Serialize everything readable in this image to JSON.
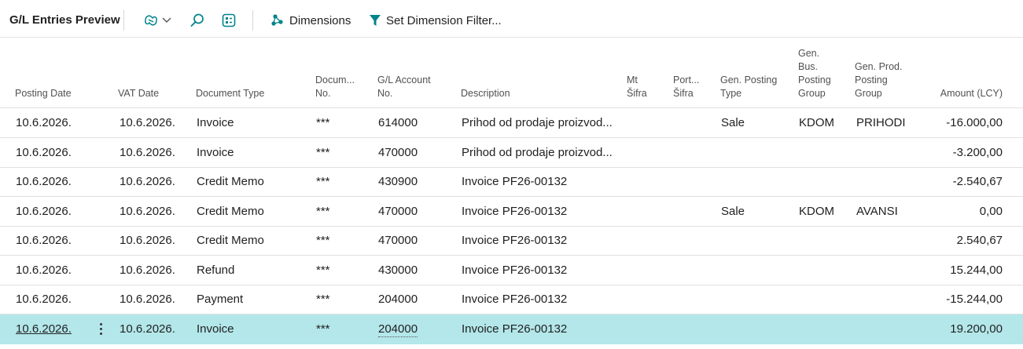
{
  "toolbar": {
    "title": "G/L Entries Preview",
    "dimensions_label": "Dimensions",
    "set_dimension_filter_label": "Set Dimension Filter...",
    "icons": [
      "copilot-icon",
      "chevron-down-icon",
      "search-icon",
      "layout-icon",
      "dimensions-icon",
      "filter-icon"
    ]
  },
  "columns": [
    {
      "key": "posting_date",
      "lines": [
        "Posting Date"
      ]
    },
    {
      "key": "vat_date",
      "lines": [
        "VAT Date"
      ]
    },
    {
      "key": "document_type",
      "lines": [
        "Document Type"
      ]
    },
    {
      "key": "document_no",
      "lines": [
        "Docum...",
        "No."
      ]
    },
    {
      "key": "gl_account_no",
      "lines": [
        "G/L Account",
        "No."
      ]
    },
    {
      "key": "description",
      "lines": [
        "Description"
      ]
    },
    {
      "key": "mt_sifra",
      "lines": [
        "Mt",
        "Šifra"
      ]
    },
    {
      "key": "port_sifra",
      "lines": [
        "Port...",
        "Šifra"
      ]
    },
    {
      "key": "gen_posting_type",
      "lines": [
        "Gen. Posting",
        "Type"
      ]
    },
    {
      "key": "gen_bus_posting_group",
      "lines": [
        "Gen.",
        "Bus.",
        "Posting",
        "Group"
      ]
    },
    {
      "key": "gen_prod_posting_group",
      "lines": [
        "Gen. Prod.",
        "Posting",
        "Group"
      ]
    },
    {
      "key": "amount_lcy",
      "lines": [
        "Amount (LCY)"
      ]
    }
  ],
  "rows": [
    {
      "posting_date": "10.6.2026.",
      "vat_date": "10.6.2026.",
      "document_type": "Invoice",
      "document_no": "***",
      "gl_account_no": "614000",
      "description": "Prihod od prodaje proizvod...",
      "mt_sifra": "",
      "port_sifra": "",
      "gen_posting_type": "Sale",
      "gen_bus_posting_group": "KDOM",
      "gen_prod_posting_group": "PRIHODI",
      "amount_lcy": "-16.000,00"
    },
    {
      "posting_date": "10.6.2026.",
      "vat_date": "10.6.2026.",
      "document_type": "Invoice",
      "document_no": "***",
      "gl_account_no": "470000",
      "description": "Prihod od prodaje proizvod...",
      "mt_sifra": "",
      "port_sifra": "",
      "gen_posting_type": "",
      "gen_bus_posting_group": "",
      "gen_prod_posting_group": "",
      "amount_lcy": "-3.200,00"
    },
    {
      "posting_date": "10.6.2026.",
      "vat_date": "10.6.2026.",
      "document_type": "Credit Memo",
      "document_no": "***",
      "gl_account_no": "430900",
      "description": "Invoice PF26-00132",
      "mt_sifra": "",
      "port_sifra": "",
      "gen_posting_type": "",
      "gen_bus_posting_group": "",
      "gen_prod_posting_group": "",
      "amount_lcy": "-2.540,67"
    },
    {
      "posting_date": "10.6.2026.",
      "vat_date": "10.6.2026.",
      "document_type": "Credit Memo",
      "document_no": "***",
      "gl_account_no": "470000",
      "description": "Invoice PF26-00132",
      "mt_sifra": "",
      "port_sifra": "",
      "gen_posting_type": "Sale",
      "gen_bus_posting_group": "KDOM",
      "gen_prod_posting_group": "AVANSI",
      "amount_lcy": "0,00"
    },
    {
      "posting_date": "10.6.2026.",
      "vat_date": "10.6.2026.",
      "document_type": "Credit Memo",
      "document_no": "***",
      "gl_account_no": "470000",
      "description": "Invoice PF26-00132",
      "mt_sifra": "",
      "port_sifra": "",
      "gen_posting_type": "",
      "gen_bus_posting_group": "",
      "gen_prod_posting_group": "",
      "amount_lcy": "2.540,67"
    },
    {
      "posting_date": "10.6.2026.",
      "vat_date": "10.6.2026.",
      "document_type": "Refund",
      "document_no": "***",
      "gl_account_no": "430000",
      "description": "Invoice PF26-00132",
      "mt_sifra": "",
      "port_sifra": "",
      "gen_posting_type": "",
      "gen_bus_posting_group": "",
      "gen_prod_posting_group": "",
      "amount_lcy": "15.244,00"
    },
    {
      "posting_date": "10.6.2026.",
      "vat_date": "10.6.2026.",
      "document_type": "Payment",
      "document_no": "***",
      "gl_account_no": "204000",
      "description": "Invoice PF26-00132",
      "mt_sifra": "",
      "port_sifra": "",
      "gen_posting_type": "",
      "gen_bus_posting_group": "",
      "gen_prod_posting_group": "",
      "amount_lcy": "-15.244,00"
    },
    {
      "posting_date": "10.6.2026.",
      "vat_date": "10.6.2026.",
      "document_type": "Invoice",
      "document_no": "***",
      "gl_account_no": "204000",
      "description": "Invoice PF26-00132",
      "mt_sifra": "",
      "port_sifra": "",
      "gen_posting_type": "",
      "gen_bus_posting_group": "",
      "gen_prod_posting_group": "",
      "amount_lcy": "19.200,00",
      "selected": true
    }
  ],
  "colors": {
    "accent": "#00838a",
    "selected_row": "#b3e7ea",
    "header_text": "#505050",
    "border": "#e1e1e1"
  }
}
